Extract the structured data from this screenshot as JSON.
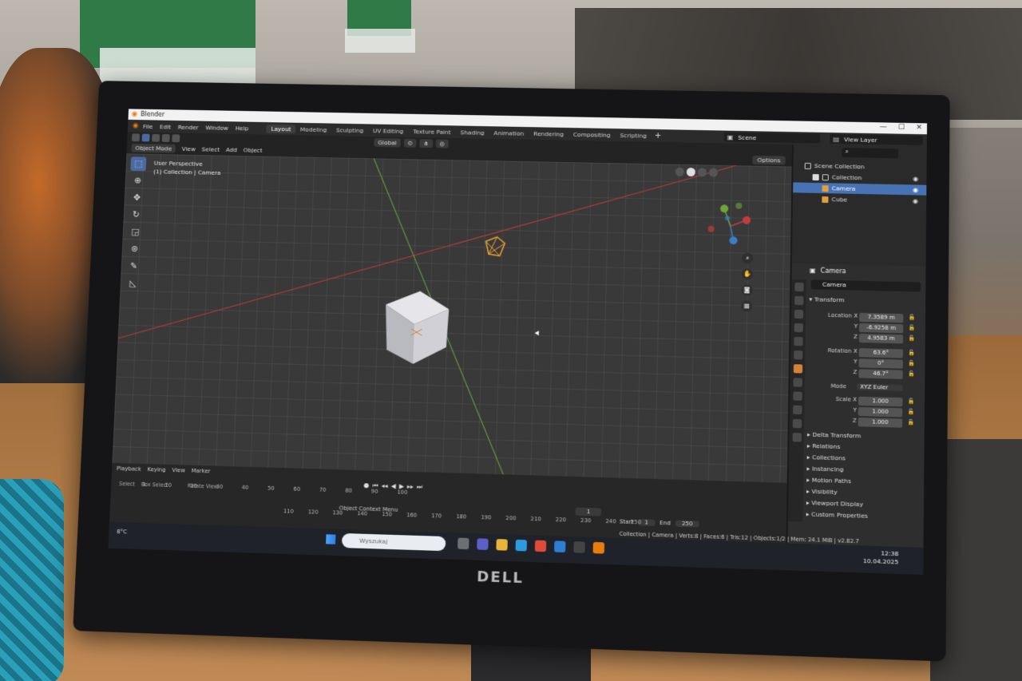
{
  "window": {
    "title": "Blender"
  },
  "menu": [
    "File",
    "Edit",
    "Render",
    "Window",
    "Help"
  ],
  "workspaces": [
    "Layout",
    "Modeling",
    "Sculpting",
    "UV Editing",
    "Texture Paint",
    "Shading",
    "Animation",
    "Rendering",
    "Compositing",
    "Scripting"
  ],
  "active_workspace": "Layout",
  "scene": "Scene",
  "view_layer": "View Layer",
  "header": {
    "mode": "Object Mode",
    "menus": [
      "View",
      "Select",
      "Add",
      "Object"
    ],
    "orientation": "Global",
    "options": "Options"
  },
  "viewport": {
    "perspective": "User Perspective",
    "collection_info": "(1) Collection | Camera"
  },
  "outliner": {
    "scene_collection": "Scene Collection",
    "collection": "Collection",
    "camera": "Camera",
    "cube": "Cube"
  },
  "properties": {
    "header": "Camera",
    "object_name": "Camera",
    "transform_label": "Transform",
    "location_label": "Location X",
    "rotation_label": "Rotation X",
    "scale_label": "Scale X",
    "y_label": "Y",
    "z_label": "Z",
    "mode_label": "Mode",
    "location": {
      "x": "7.3589 m",
      "y": "-6.9258 m",
      "z": "4.9583 m"
    },
    "rotation": {
      "x": "63.6°",
      "y": "0°",
      "z": "46.7°"
    },
    "rotation_mode": "XYZ Euler",
    "scale": {
      "x": "1.000",
      "y": "1.000",
      "z": "1.000"
    },
    "panels": [
      "Delta Transform",
      "Relations",
      "Collections",
      "Instancing",
      "Motion Paths",
      "Visibility",
      "Viewport Display",
      "Custom Properties"
    ]
  },
  "timeline": {
    "menus": [
      "Playback",
      "Keying",
      "View",
      "Marker"
    ],
    "frame_numbers_top": [
      "1",
      "10",
      "20",
      "30",
      "40",
      "50",
      "60",
      "70",
      "80",
      "90",
      "100"
    ],
    "frame_numbers_bottom": [
      "110",
      "120",
      "130",
      "140",
      "150",
      "160",
      "170",
      "180",
      "190",
      "200",
      "210",
      "220",
      "230",
      "240",
      "250"
    ],
    "current_frame": "1",
    "start_label": "Start",
    "start": "1",
    "end_label": "End",
    "end": "250",
    "status_left": "Select",
    "status_box": "Box Select",
    "status_rotate": "Rotate View",
    "context_menu": "Object Context Menu"
  },
  "statusbar": "Collection | Camera | Verts:8 | Faces:6 | Tris:12 | Objects:1/2 | Mem: 24.1 MiB | v2.82.7",
  "taskbar": {
    "search_placeholder": "Wyszukaj",
    "time": "12:38",
    "date": "10.04.2025",
    "weather": "8°C"
  },
  "monitor_brand": "DELL",
  "colors": {
    "accent": "#4772b3",
    "blender_orange": "#e87d0d",
    "x_axis": "#c43b3b",
    "y_axis": "#6fa43a"
  }
}
